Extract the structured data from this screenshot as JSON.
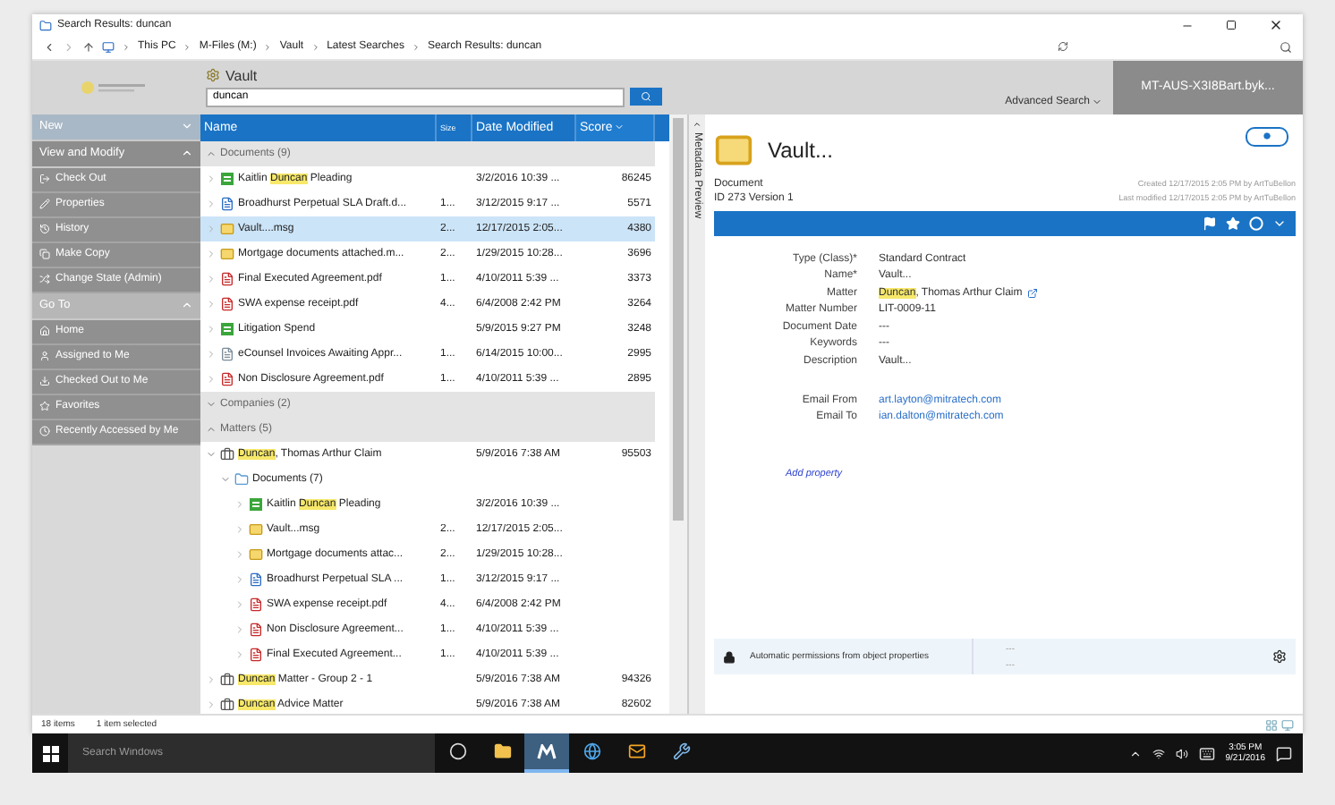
{
  "window": {
    "title": "Search Results: duncan"
  },
  "address": {
    "path": [
      "This PC",
      "M-Files (M:)",
      "Vault",
      "Latest Searches",
      "Search Results: duncan"
    ]
  },
  "header": {
    "vault": "Vault",
    "search": {
      "value": "duncan"
    },
    "advanced_search": "Advanced Search",
    "user": "MT-AUS-X3I8Bart.byk..."
  },
  "sidebar": {
    "sections": [
      {
        "title": "New",
        "expanded": false,
        "kind": "primary"
      },
      {
        "title": "View and Modify",
        "expanded": true,
        "kind": "task",
        "items": [
          {
            "label": "Check Out",
            "kind": "check-out"
          },
          {
            "label": "Properties",
            "kind": "properties"
          },
          {
            "label": "History",
            "kind": "history"
          },
          {
            "label": "Make Copy",
            "kind": "copy"
          },
          {
            "label": "Change State (Admin)",
            "kind": "state"
          }
        ]
      },
      {
        "title": "Go To",
        "expanded": true,
        "kind": "goto",
        "items": [
          {
            "label": "Home",
            "kind": "home"
          },
          {
            "label": "Assigned to Me",
            "kind": "assigned"
          },
          {
            "label": "Checked Out to Me",
            "kind": "checked-out"
          },
          {
            "label": "Favorites",
            "kind": "favorites"
          },
          {
            "label": "Recently Accessed by Me",
            "kind": "recent"
          }
        ]
      }
    ]
  },
  "list": {
    "columns": [
      {
        "label": "Name",
        "sorted": false
      },
      {
        "label": "Size",
        "sorted": false
      },
      {
        "label": "Date Modified",
        "sorted": false
      },
      {
        "label": "Score",
        "sorted": true
      }
    ],
    "groups": [
      {
        "title": "Documents (9)",
        "expanded": true,
        "rows": [
          {
            "kind": "doc",
            "name": [
              {
                "text": "Kaitlin "
              },
              {
                "text": "Duncan",
                "hit": true
              },
              {
                "text": " Pleading"
              }
            ],
            "date": "3/2/2016 10:39 ...",
            "score": "86245",
            "selected": false,
            "expanded": false
          },
          {
            "kind": "word",
            "name": [
              {
                "text": "Broadhurst Perpetual SLA Draft.d..."
              }
            ],
            "size": "1...",
            "date": "3/12/2015 9:17 ...",
            "score": "5571",
            "selected": false,
            "expanded": false
          },
          {
            "kind": "email",
            "name": [
              {
                "text": "Vault....msg"
              }
            ],
            "size": "2...",
            "date": "12/17/2015 2:05...",
            "score": "4380",
            "selected": true,
            "expanded": false
          },
          {
            "kind": "email",
            "name": [
              {
                "text": "Mortgage documents attached.m..."
              }
            ],
            "size": "2...",
            "date": "1/29/2015 10:28...",
            "score": "3696",
            "selected": false,
            "expanded": false
          },
          {
            "kind": "pdf",
            "name": [
              {
                "text": "Final Executed Agreement.pdf"
              }
            ],
            "size": "1...",
            "date": "4/10/2011 5:39 ...",
            "score": "3373",
            "selected": false,
            "expanded": false
          },
          {
            "kind": "pdf",
            "name": [
              {
                "text": "SWA expense receipt.pdf"
              }
            ],
            "size": "4...",
            "date": "6/4/2008 2:42 PM",
            "score": "3264",
            "selected": false,
            "expanded": false
          },
          {
            "kind": "doc",
            "name": [
              {
                "text": "Litigation Spend"
              }
            ],
            "date": "5/9/2015 9:27 PM",
            "score": "3248",
            "selected": false,
            "expanded": false
          },
          {
            "kind": "invoice",
            "name": [
              {
                "text": "eCounsel Invoices Awaiting Appr..."
              }
            ],
            "size": "1...",
            "date": "6/14/2015 10:00...",
            "score": "2995",
            "selected": false,
            "expanded": false
          },
          {
            "kind": "pdf",
            "name": [
              {
                "text": "Non Disclosure Agreement.pdf"
              }
            ],
            "size": "1...",
            "date": "4/10/2011 5:39 ...",
            "score": "2895",
            "selected": false,
            "expanded": false
          }
        ]
      },
      {
        "title": "Companies (2)",
        "expanded": false
      },
      {
        "title": "Matters (5)",
        "expanded": true,
        "rows": [
          {
            "kind": "matter",
            "name": [
              {
                "text": "Duncan",
                "hit": true
              },
              {
                "text": ", Thomas Arthur Claim"
              }
            ],
            "date": "5/9/2016 7:38 AM",
            "score": "95503",
            "selected": false,
            "expanded": true,
            "children": [
              {
                "kind": "folder",
                "name": [
                  {
                    "text": "Documents (7)"
                  }
                ],
                "selected": false,
                "expanded": true,
                "children": [
                  {
                    "kind": "doc",
                    "name": [
                      {
                        "text": "Kaitlin "
                      },
                      {
                        "text": "Duncan",
                        "hit": true
                      },
                      {
                        "text": " Pleading"
                      }
                    ],
                    "date": "3/2/2016 10:39 ...",
                    "selected": false,
                    "expanded": false
                  },
                  {
                    "kind": "email",
                    "name": [
                      {
                        "text": "Vault...msg"
                      }
                    ],
                    "size": "2...",
                    "date": "12/17/2015 2:05...",
                    "selected": false,
                    "expanded": false
                  },
                  {
                    "kind": "email",
                    "name": [
                      {
                        "text": "Mortgage documents attac..."
                      }
                    ],
                    "size": "2...",
                    "date": "1/29/2015 10:28...",
                    "selected": false,
                    "expanded": false
                  },
                  {
                    "kind": "word",
                    "name": [
                      {
                        "text": "Broadhurst Perpetual SLA ..."
                      }
                    ],
                    "size": "1...",
                    "date": "3/12/2015 9:17 ...",
                    "selected": false,
                    "expanded": false
                  },
                  {
                    "kind": "pdf",
                    "name": [
                      {
                        "text": "SWA expense receipt.pdf"
                      }
                    ],
                    "size": "4...",
                    "date": "6/4/2008 2:42 PM",
                    "selected": false,
                    "expanded": false
                  },
                  {
                    "kind": "pdf",
                    "name": [
                      {
                        "text": "Non Disclosure Agreement..."
                      }
                    ],
                    "size": "1...",
                    "date": "4/10/2011 5:39 ...",
                    "selected": false,
                    "expanded": false
                  },
                  {
                    "kind": "pdf",
                    "name": [
                      {
                        "text": "Final Executed Agreement..."
                      }
                    ],
                    "size": "1...",
                    "date": "4/10/2011 5:39 ...",
                    "selected": false,
                    "expanded": false
                  }
                ]
              }
            ]
          },
          {
            "kind": "matter",
            "name": [
              {
                "text": "Duncan",
                "hit": true
              },
              {
                "text": " Matter - Group 2 - 1"
              }
            ],
            "date": "5/9/2016 7:38 AM",
            "score": "94326",
            "selected": false,
            "expanded": false
          },
          {
            "kind": "matter",
            "name": [
              {
                "text": "Duncan",
                "hit": true
              },
              {
                "text": " Advice Matter"
              }
            ],
            "date": "5/9/2016 7:38 AM",
            "score": "82602",
            "selected": false,
            "expanded": false
          }
        ]
      }
    ]
  },
  "preview": {
    "tab": "Metadata Preview",
    "title": "Vault...",
    "class": "Document",
    "id": "ID 273 Version 1",
    "created": "Created 12/17/2015 2:05 PM by ArtTuBellon",
    "modified": "Last modified 12/17/2015 2:05 PM by ArtTuBellon",
    "properties": [
      {
        "label": "Type (Class)*",
        "kind": "text",
        "value": [
          {
            "text": "Standard Contract"
          }
        ]
      },
      {
        "label": "Name*",
        "kind": "text",
        "value": [
          {
            "text": "Vault..."
          }
        ]
      },
      {
        "label": "Matter",
        "kind": "lookup",
        "value": [
          {
            "text": "Duncan",
            "hit": true
          },
          {
            "text": ", Thomas Arthur Claim"
          }
        ]
      },
      {
        "label": "Matter Number",
        "kind": "text",
        "value": [
          {
            "text": "LIT-0009-11"
          }
        ]
      },
      {
        "label": "Document Date",
        "kind": "text",
        "value": [
          {
            "text": "---"
          }
        ]
      },
      {
        "label": "Keywords",
        "kind": "text",
        "value": [
          {
            "text": "---"
          }
        ]
      },
      {
        "label": "Description",
        "kind": "text",
        "value": [
          {
            "text": "Vault..."
          }
        ]
      }
    ],
    "email_properties": [
      {
        "label": "Email From",
        "kind": "link",
        "value": [
          {
            "text": "art.layton@mitratech.com"
          }
        ]
      },
      {
        "label": "Email To",
        "kind": "link",
        "value": [
          {
            "text": "ian.dalton@mitratech.com"
          }
        ]
      }
    ],
    "add_property": "Add property",
    "permissions": {
      "text": "Automatic permissions from object properties",
      "values": [
        "---",
        "---"
      ]
    }
  },
  "status": {
    "items": "18 items",
    "selection": "1 item selected"
  },
  "taskbar": {
    "search_placeholder": "Search Windows",
    "apps": [
      {
        "kind": "task-view",
        "selected": false
      },
      {
        "kind": "explorer",
        "selected": false
      },
      {
        "kind": "m-files",
        "selected": true
      },
      {
        "kind": "browser",
        "selected": false
      },
      {
        "kind": "mail",
        "selected": false
      },
      {
        "kind": "tool",
        "selected": false
      }
    ],
    "time": "3:05 PM",
    "date": "9/21/2016"
  }
}
